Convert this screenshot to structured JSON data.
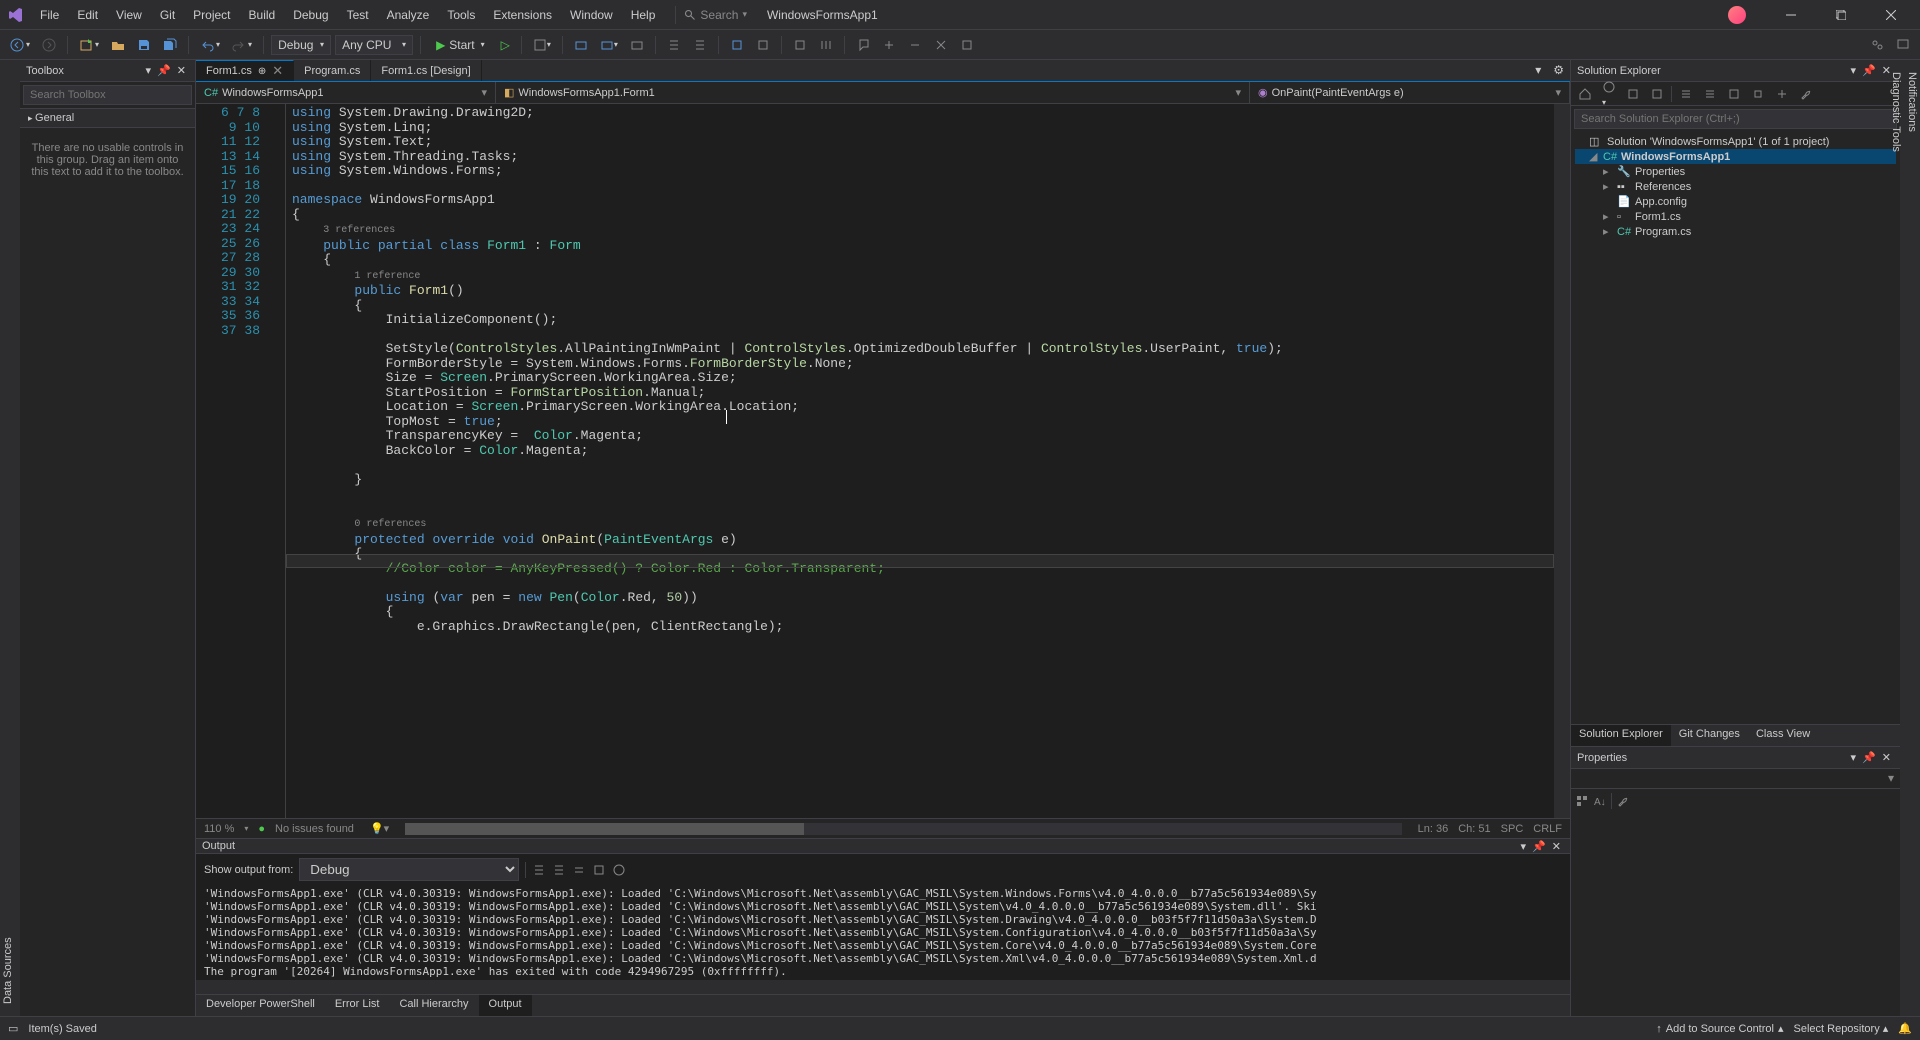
{
  "title": "WindowsFormsApp1",
  "menu": [
    "File",
    "Edit",
    "View",
    "Git",
    "Project",
    "Build",
    "Debug",
    "Test",
    "Analyze",
    "Tools",
    "Extensions",
    "Window",
    "Help"
  ],
  "search_placeholder": "Search",
  "toolbar": {
    "config": "Debug",
    "platform": "Any CPU",
    "start": "Start"
  },
  "side_left": [
    "Data Sources"
  ],
  "side_right": [
    "Notifications",
    "Diagnostic Tools"
  ],
  "toolbox": {
    "title": "Toolbox",
    "search_placeholder": "Search Toolbox",
    "section": "General",
    "empty": "There are no usable controls in this group. Drag an item onto this text to add it to the toolbox."
  },
  "tabs": [
    {
      "label": "Form1.cs",
      "active": true,
      "pinned": true
    },
    {
      "label": "Program.cs",
      "active": false
    },
    {
      "label": "Form1.cs [Design]",
      "active": false
    }
  ],
  "nav": {
    "project": "WindowsFormsApp1",
    "class": "WindowsFormsApp1.Form1",
    "member": "OnPaint(PaintEventArgs e)"
  },
  "editor": {
    "first_line": 6,
    "zoom": "110 %",
    "issues": "No issues found",
    "lncol": {
      "ln": "Ln: 36",
      "ch": "Ch: 51",
      "spc": "SPC",
      "crlf": "CRLF"
    },
    "refs": {
      "r3": "3 references",
      "r1": "1 reference",
      "r0": "0 references"
    }
  },
  "output": {
    "title": "Output",
    "show_from_label": "Show output from:",
    "show_from": "Debug",
    "lines": [
      "'WindowsFormsApp1.exe' (CLR v4.0.30319: WindowsFormsApp1.exe): Loaded 'C:\\Windows\\Microsoft.Net\\assembly\\GAC_MSIL\\System.Windows.Forms\\v4.0_4.0.0.0__b77a5c561934e089\\Sy",
      "'WindowsFormsApp1.exe' (CLR v4.0.30319: WindowsFormsApp1.exe): Loaded 'C:\\Windows\\Microsoft.Net\\assembly\\GAC_MSIL\\System\\v4.0_4.0.0.0__b77a5c561934e089\\System.dll'. Ski",
      "'WindowsFormsApp1.exe' (CLR v4.0.30319: WindowsFormsApp1.exe): Loaded 'C:\\Windows\\Microsoft.Net\\assembly\\GAC_MSIL\\System.Drawing\\v4.0_4.0.0.0__b03f5f7f11d50a3a\\System.D",
      "'WindowsFormsApp1.exe' (CLR v4.0.30319: WindowsFormsApp1.exe): Loaded 'C:\\Windows\\Microsoft.Net\\assembly\\GAC_MSIL\\System.Configuration\\v4.0_4.0.0.0__b03f5f7f11d50a3a\\Sy",
      "'WindowsFormsApp1.exe' (CLR v4.0.30319: WindowsFormsApp1.exe): Loaded 'C:\\Windows\\Microsoft.Net\\assembly\\GAC_MSIL\\System.Core\\v4.0_4.0.0.0__b77a5c561934e089\\System.Core",
      "'WindowsFormsApp1.exe' (CLR v4.0.30319: WindowsFormsApp1.exe): Loaded 'C:\\Windows\\Microsoft.Net\\assembly\\GAC_MSIL\\System.Xml\\v4.0_4.0.0.0__b77a5c561934e089\\System.Xml.d",
      "The program '[20264] WindowsFormsApp1.exe' has exited with code 4294967295 (0xffffffff)."
    ]
  },
  "bottom_tabs": [
    "Developer PowerShell",
    "Error List",
    "Call Hierarchy",
    "Output"
  ],
  "sol": {
    "title": "Solution Explorer",
    "search_placeholder": "Search Solution Explorer (Ctrl+;)",
    "root": "Solution 'WindowsFormsApp1' (1 of 1 project)",
    "project": "WindowsFormsApp1",
    "items": [
      "Properties",
      "References",
      "App.config",
      "Form1.cs",
      "Program.cs"
    ]
  },
  "sol_tabs": [
    "Solution Explorer",
    "Git Changes",
    "Class View"
  ],
  "properties": {
    "title": "Properties"
  },
  "statusbar": {
    "ready": "Item(s) Saved",
    "add_src": "Add to Source Control",
    "select_repo": "Select Repository"
  }
}
